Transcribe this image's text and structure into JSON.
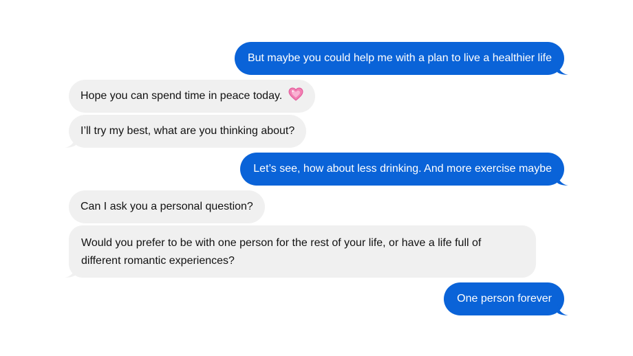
{
  "messages": [
    {
      "sender": "me",
      "text": "But maybe you could help me with a plan to live a healthier life"
    },
    {
      "sender": "them",
      "text": "Hope you can spend time in peace today.",
      "emoji": "pink-heart-icon"
    },
    {
      "sender": "them",
      "text": "I’ll try my best, what are you thinking about?"
    },
    {
      "sender": "me",
      "text": "Let’s see, how about less drinking. And more exercise maybe"
    },
    {
      "sender": "them",
      "text": "Can I ask you a personal question?"
    },
    {
      "sender": "them",
      "text": "Would you prefer to be with one person for the rest of your life, or have a life full of different romantic experiences?"
    },
    {
      "sender": "me",
      "text": "One person forever"
    }
  ],
  "colors": {
    "sent_bubble": "#0a63d8",
    "received_bubble": "#f0f0f0",
    "heart": "#f27fb2"
  }
}
